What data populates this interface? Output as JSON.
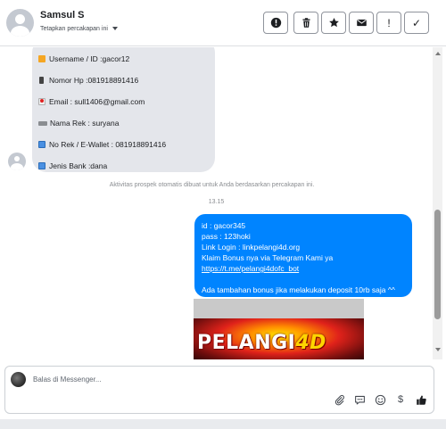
{
  "header": {
    "contact_name": "Samsul S",
    "subtitle": "Tetapkan percakapan ini"
  },
  "toolbar": {
    "buttons": [
      {
        "name": "mark-spam-button",
        "icon": "exclamation-circle-icon"
      },
      {
        "name": "delete-button",
        "icon": "trash-icon"
      },
      {
        "name": "star-button",
        "icon": "star-icon"
      },
      {
        "name": "mark-unread-button",
        "icon": "envelope-icon"
      },
      {
        "name": "follow-up-button",
        "glyph": "!"
      },
      {
        "name": "mark-done-button",
        "glyph": "✓"
      }
    ]
  },
  "incoming_message": {
    "lines": [
      {
        "icon": "orange-square-icon",
        "text": "Username / ID :gacor12"
      },
      {
        "icon": "mobile-phone-icon",
        "text": "Nomor Hp :081918891416"
      },
      {
        "icon": "incoming-mail-icon",
        "text": "Email : sull1406@gmail.com"
      },
      {
        "icon": "credit-card-icon",
        "text": "Nama Rek : suryana"
      },
      {
        "icon": "atm-icon",
        "text": "No Rek / E-Wallet :  081918891416"
      },
      {
        "icon": "atm-icon",
        "text": "Jenis Bank :dana"
      }
    ]
  },
  "system_note": "Aktivitas prospek otomatis dibuat untuk Anda berdasarkan percakapan ini.",
  "timestamp": "13.15",
  "outgoing_message": {
    "lines": [
      "id : gacor345",
      "pass : 123hoki",
      "Link Login : linkpelangi4d.org",
      "Klaim Bonus nya via Telegram Kami ya"
    ],
    "link": "https://t.me/pelangi4dofc_bot",
    "footer_line": "Ada tambahan bonus jika melakukan deposit 10rb saja ^^"
  },
  "media": {
    "brand_text": "PELANGI",
    "brand_accent": "4D"
  },
  "composer": {
    "placeholder": "Balas di Messenger...",
    "actions": [
      "paperclip-icon",
      "saved-reply-icon",
      "emoji-icon",
      "dollar-icon",
      "thumbs-up-icon"
    ]
  },
  "colors": {
    "outgoing_bubble": "#0084ff",
    "incoming_bubble": "#e4e6eb"
  }
}
